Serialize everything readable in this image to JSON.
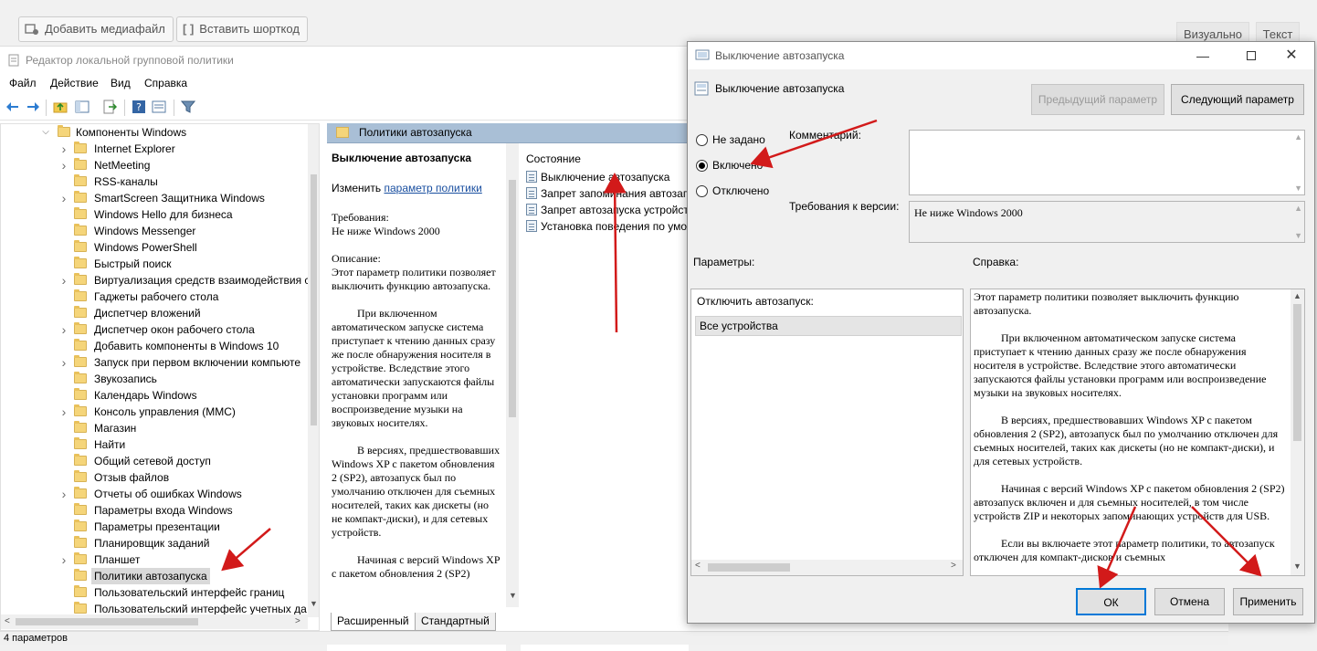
{
  "wp_toolbar": {
    "add_media": "Добавить медиафайл",
    "insert_shortcode": "Вставить шорткод",
    "tab_visual": "Визуально",
    "tab_text": "Текст"
  },
  "gpedit": {
    "title": "Редактор локальной групповой политики",
    "menu": [
      "Файл",
      "Действие",
      "Вид",
      "Справка"
    ],
    "tree": {
      "root": "Компоненты Windows",
      "items": [
        "Internet Explorer",
        "NetMeeting",
        "RSS-каналы",
        "SmartScreen Защитника Windows",
        "Windows Hello для бизнеса",
        "Windows Messenger",
        "Windows PowerShell",
        "Быстрый поиск",
        "Виртуализация средств взаимодействия с",
        "Гаджеты рабочего стола",
        "Диспетчер вложений",
        "Диспетчер окон рабочего стола",
        "Добавить компоненты в Windows 10",
        "Запуск при первом включении компьюте",
        "Звукозапись",
        "Календарь Windows",
        "Консоль управления (MMC)",
        "Магазин",
        "Найти",
        "Общий сетевой доступ",
        "Отзыв файлов",
        "Отчеты об ошибках Windows",
        "Параметры входа Windows",
        "Параметры презентации",
        "Планировщик заданий",
        "Планшет",
        "Политики автозапуска",
        "Пользовательский интерфейс границ",
        "Пользовательский интерфейс учетных да"
      ],
      "selected": "Политики автозапуска"
    },
    "folder_header": "Политики автозапуска",
    "desc": {
      "title": "Выключение автозапуска",
      "edit_prefix": "Изменить",
      "edit_link": "параметр политики",
      "req_label": "Требования:",
      "req_value": "Не ниже Windows 2000",
      "desc_label": "Описание:",
      "p1": "Этот параметр политики позволяет выключить функцию автозапуска.",
      "p2": "При включенном автоматическом запуске система приступает к чтению данных сразу же после обнаружения носителя в устройстве. Вследствие этого автоматически запускаются файлы установки программ или воспроизведение музыки на звуковых носителях.",
      "p3": "В версиях, предшествовавших Windows XP с пакетом обновления 2 (SP2), автозапуск был по умолчанию отключен для съемных носителей, таких как дискеты (но не компакт-диски), и для сетевых устройств.",
      "p4": "Начиная с версий Windows XP с пакетом обновления 2 (SP2)"
    },
    "list": {
      "column": "Состояние",
      "items": [
        "Выключение автозапуска",
        "Запрет запоминания автозапуска",
        "Запрет автозапуска устройств",
        "Установка поведения по умолчанию"
      ]
    },
    "tabs": [
      "Расширенный",
      "Стандартный"
    ],
    "status": "4 параметров"
  },
  "dialog": {
    "window_title": "Выключение автозапуска",
    "policy_name": "Выключение автозапуска",
    "prev_button": "Предыдущий параметр",
    "next_button": "Следующий параметр",
    "radio_not_configured": "Не задано",
    "radio_enabled": "Включено",
    "radio_disabled": "Отключено",
    "selected_radio": "Включено",
    "comment_label": "Комментарий:",
    "comment_value": "",
    "supported_label": "Требования к версии:",
    "supported_value": "Не ниже Windows 2000",
    "options_label": "Параметры:",
    "help_label": "Справка:",
    "option_name": "Отключить автозапуск:",
    "option_value": "Все устройства",
    "help": {
      "p1": "Этот параметр политики позволяет выключить функцию автозапуска.",
      "p2": "При включенном автоматическом запуске система приступает к чтению данных сразу же после обнаружения носителя в устройстве. Вследствие этого автоматически запускаются файлы установки программ или воспроизведение музыки на звуковых носителях.",
      "p3": "В версиях, предшествовавших Windows XP с пакетом обновления 2 (SP2), автозапуск был по умолчанию отключен для съемных носителей, таких как дискеты (но не компакт-диски), и для сетевых устройств.",
      "p4": "Начиная с версий Windows XP с пакетом обновления 2 (SP2) автозапуск включен и для съемных носителей, в том числе устройств ZIP и некоторых запоминающих устройств для USB.",
      "p5": "Если вы включаете этот параметр политики, то автозапуск отключен для компакт-дисков и съемных"
    },
    "ok_button": "ОК",
    "cancel_button": "Отмена",
    "apply_button": "Применить"
  },
  "colors": {
    "annotation_arrow": "#d21a1a",
    "folder_header_bg": "#a9bfd6",
    "link": "#1a4fa0"
  }
}
